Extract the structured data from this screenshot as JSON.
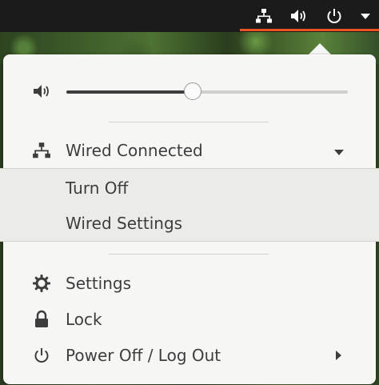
{
  "top_bar": {
    "indicators": [
      {
        "icon": "network-wired-icon"
      },
      {
        "icon": "speaker-volume-icon"
      },
      {
        "icon": "power-icon"
      },
      {
        "icon": "caret-down-icon"
      }
    ],
    "accent_color": "#e95420"
  },
  "volume": {
    "icon": "speaker-volume-icon",
    "level": 0.45
  },
  "network": {
    "icon": "network-wired-icon",
    "label": "Wired Connected",
    "submenu": {
      "turn_off": "Turn Off",
      "settings": "Wired Settings"
    }
  },
  "system": {
    "settings_label": "Settings",
    "lock_label": "Lock",
    "power_label": "Power Off / Log Out"
  }
}
